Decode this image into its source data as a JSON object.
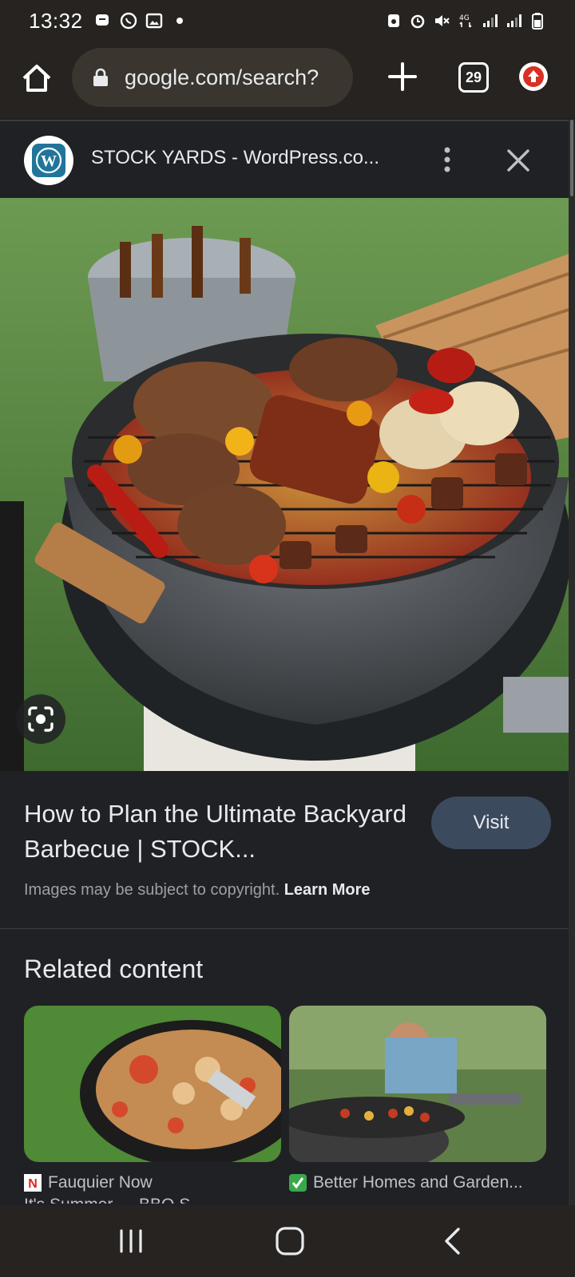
{
  "status_bar": {
    "time": "13:32"
  },
  "toolbar": {
    "url": "google.com/search?",
    "tab_count": "29"
  },
  "source": {
    "site_title": "STOCK YARDS - WordPress.co...",
    "logo_letter": "W"
  },
  "result": {
    "title": "How to Plan the Ultimate Backyard Barbecue | STOCK...",
    "visit_label": "Visit",
    "copyright_text": "Images may be subject to copyright.",
    "learn_more": "Learn More"
  },
  "related": {
    "heading": "Related content",
    "items": [
      {
        "source": "Fauquier Now",
        "favicon_letter": "N"
      },
      {
        "source": "Better Homes and Garden..."
      }
    ],
    "peek_text": "It's Summer — BBQ S..."
  },
  "colors": {
    "background": "#202124",
    "chrome": "#262320",
    "visit_button": "#3c4a5e"
  }
}
